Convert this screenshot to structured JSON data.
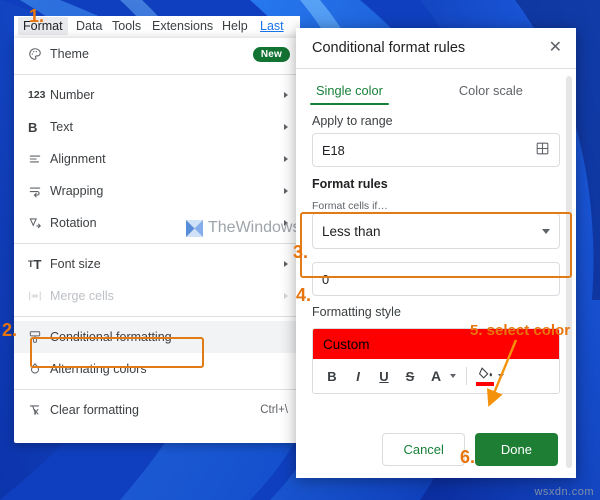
{
  "background": {
    "name": "windows-11-bloom-wallpaper",
    "base_color": "#0f47c8"
  },
  "menubar": {
    "items": [
      {
        "label": "Format",
        "active": true
      },
      {
        "label": "Data",
        "active": false
      },
      {
        "label": "Tools",
        "active": false
      },
      {
        "label": "Extensions",
        "active": false
      },
      {
        "label": "Help",
        "active": false
      },
      {
        "label": "Last",
        "active": false,
        "link": true
      }
    ]
  },
  "menu": {
    "items": [
      {
        "label": "Theme",
        "icon": "palette-icon",
        "badge": "New",
        "submenu": false,
        "disabled": false
      },
      {
        "separator": true
      },
      {
        "label": "Number",
        "icon": "number-123-icon",
        "submenu": true,
        "disabled": false
      },
      {
        "label": "Text",
        "icon": "bold-b-icon",
        "submenu": true,
        "disabled": false
      },
      {
        "label": "Alignment",
        "icon": "align-left-icon",
        "submenu": true,
        "disabled": false
      },
      {
        "label": "Wrapping",
        "icon": "text-wrap-icon",
        "submenu": true,
        "disabled": false
      },
      {
        "label": "Rotation",
        "icon": "text-rotation-icon",
        "submenu": true,
        "disabled": false
      },
      {
        "separator": true
      },
      {
        "label": "Font size",
        "icon": "font-size-icon",
        "submenu": true,
        "disabled": false
      },
      {
        "label": "Merge cells",
        "icon": "merge-cells-icon",
        "submenu": true,
        "disabled": true
      },
      {
        "separator": true
      },
      {
        "label": "Conditional formatting",
        "icon": "conditional-formatting-icon",
        "submenu": false,
        "disabled": false,
        "highlighted": true
      },
      {
        "label": "Alternating colors",
        "icon": "alternating-colors-icon",
        "submenu": false,
        "disabled": false
      },
      {
        "separator": true
      },
      {
        "label": "Clear formatting",
        "icon": "clear-formatting-icon",
        "accel": "Ctrl+\\",
        "submenu": false,
        "disabled": false
      }
    ]
  },
  "panel": {
    "title": "Conditional format rules",
    "close_icon": "close-icon",
    "tabs": [
      {
        "label": "Single color",
        "active": true
      },
      {
        "label": "Color scale",
        "active": false
      }
    ],
    "apply_to_range": {
      "label": "Apply to range",
      "value": "E18",
      "picker_icon": "grid-select-icon"
    },
    "format_rules": {
      "heading": "Format rules",
      "condition_label": "Format cells if…",
      "condition_value": "Less than",
      "condition_caret": "chevron-down-icon",
      "threshold_value": "0"
    },
    "formatting_style": {
      "label": "Formatting style",
      "preview_text": "Custom",
      "preview_bg": "#FF0000",
      "preview_fg": "#202124",
      "buttons": [
        {
          "name": "bold-button",
          "glyph": "B"
        },
        {
          "name": "italic-button",
          "glyph": "I"
        },
        {
          "name": "underline-button",
          "glyph": "U"
        },
        {
          "name": "strikethrough-button",
          "glyph": "S"
        },
        {
          "name": "text-color-button",
          "glyph": "A"
        },
        {
          "name": "fill-color-button",
          "glyph": "◆"
        }
      ],
      "fill_color": "#FF0000"
    },
    "actions": {
      "cancel_label": "Cancel",
      "done_label": "Done",
      "done_color": "#1e7e34",
      "cancel_color": "#188038"
    }
  },
  "annotations": {
    "accent_color": "#e8740c",
    "items": [
      {
        "text": "1.",
        "name": "annotation-step-1"
      },
      {
        "text": "2.",
        "name": "annotation-step-2"
      },
      {
        "text": "3.",
        "name": "annotation-step-3"
      },
      {
        "text": "4.",
        "name": "annotation-step-4"
      },
      {
        "text": "5. select color",
        "name": "annotation-step-5"
      },
      {
        "text": "6.",
        "name": "annotation-step-6"
      }
    ]
  },
  "watermarks": {
    "brand": "TheWindowsClub",
    "corner": "wsxdn.com"
  }
}
